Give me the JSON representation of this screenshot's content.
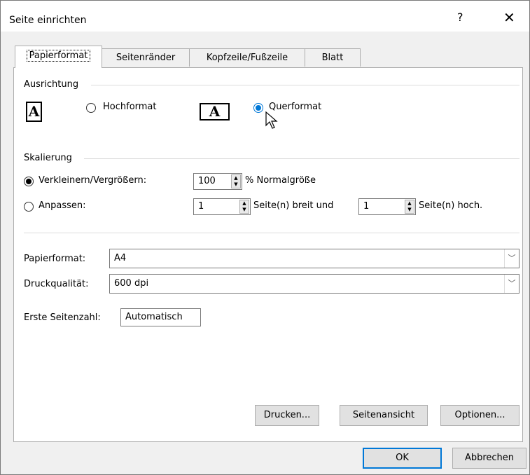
{
  "dialog": {
    "title": "Seite einrichten",
    "help": "?",
    "close": "✕"
  },
  "tabs": [
    {
      "label": "Papierformat",
      "active": true
    },
    {
      "label": "Seitenränder",
      "active": false
    },
    {
      "label": "Kopfzeile/Fußzeile",
      "active": false
    },
    {
      "label": "Blatt",
      "active": false
    }
  ],
  "orientation": {
    "section_label": "Ausrichtung",
    "portrait_label": "Hochformat",
    "landscape_label": "Querformat",
    "selected": "landscape",
    "icon_glyph": "A"
  },
  "scaling": {
    "section_label": "Skalierung",
    "adjust_label": "Verkleinern/Vergrößern:",
    "adjust_value": "100",
    "adjust_suffix": "% Normalgröße",
    "fit_label": "Anpassen:",
    "fit_wide_value": "1",
    "fit_wide_suffix": "Seite(n) breit und",
    "fit_tall_value": "1",
    "fit_tall_suffix": "Seite(n) hoch.",
    "selected": "adjust"
  },
  "paper": {
    "size_label": "Papierformat:",
    "size_value": "A4",
    "quality_label": "Druckqualität:",
    "quality_value": "600 dpi",
    "first_page_label": "Erste Seitenzahl:",
    "first_page_value": "Automatisch"
  },
  "panel_buttons": {
    "print": "Drucken...",
    "preview": "Seitenansicht",
    "options": "Optionen..."
  },
  "footer_buttons": {
    "ok": "OK",
    "cancel": "Abbrechen"
  },
  "colors": {
    "accent": "#0078d7"
  }
}
